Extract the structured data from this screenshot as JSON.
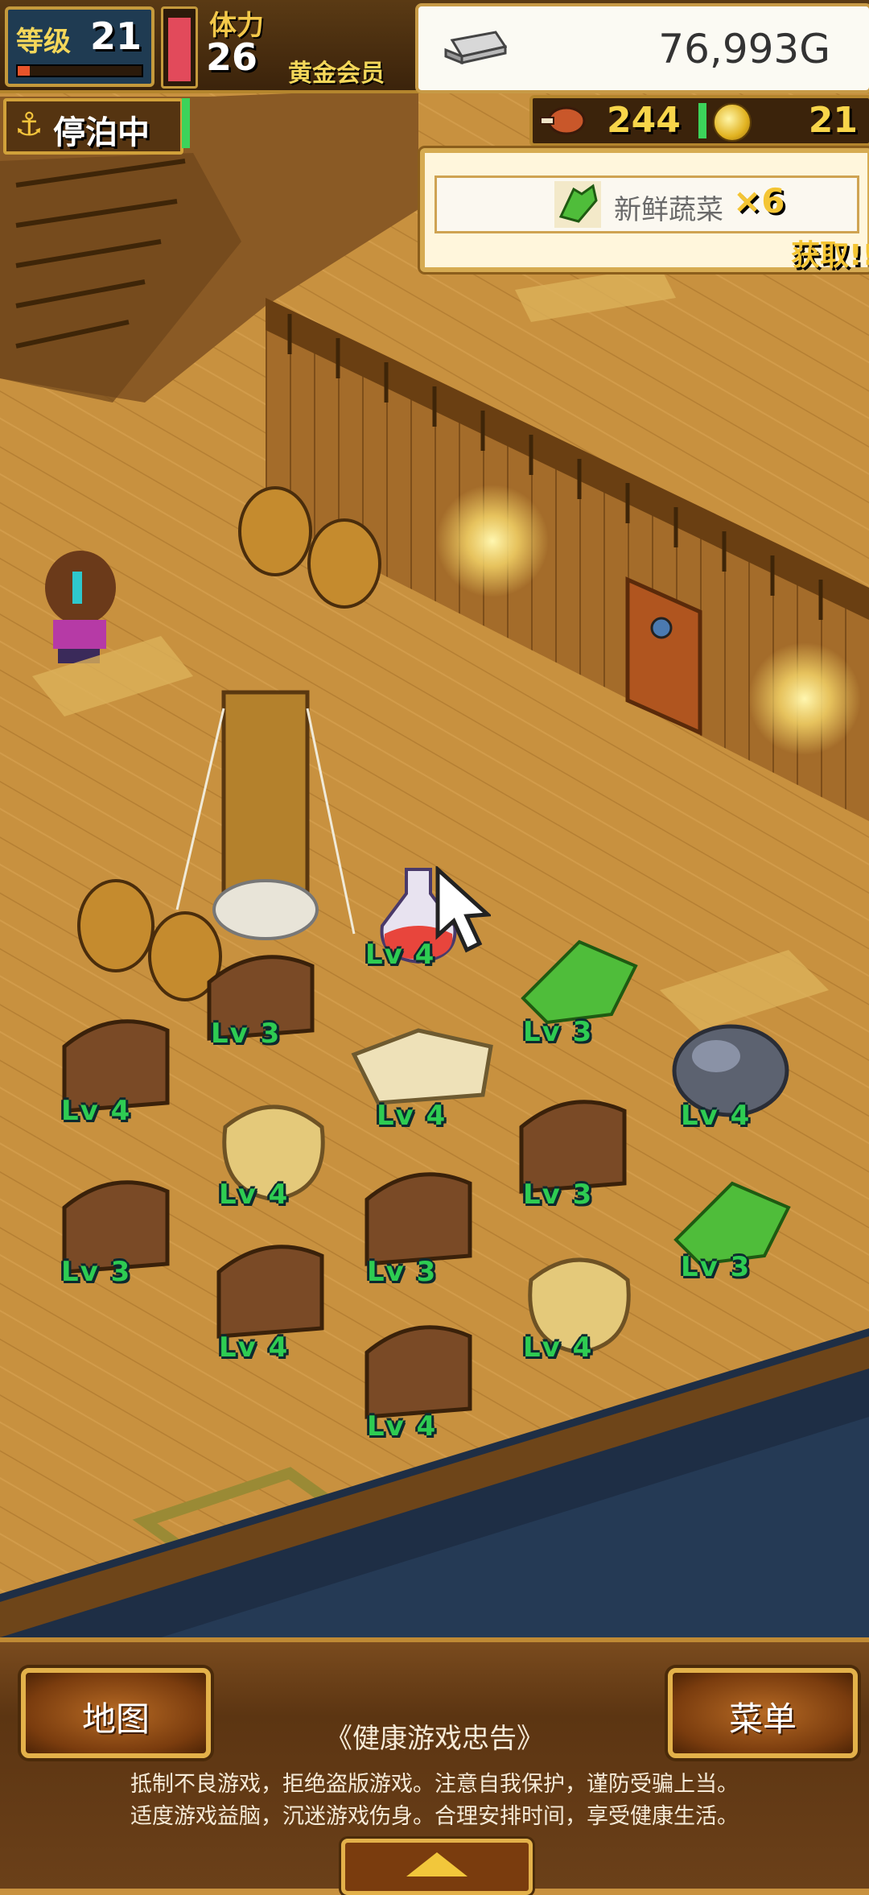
{
  "hud": {
    "level_label": "等级",
    "level_value": "21",
    "stamina_label": "体力",
    "stamina_value": "26",
    "member_label": "黄金会员",
    "gold_value": "76,993G",
    "docked_label": "停泊中",
    "food_value": "244",
    "coin_value": "21"
  },
  "notification": {
    "item_name": "新鲜蔬菜",
    "multiplier": "×6",
    "claim_label": "获取!!"
  },
  "items": [
    {
      "kind": "potion",
      "level": "Lv 4"
    },
    {
      "kind": "chest",
      "level": "Lv 3"
    },
    {
      "kind": "vegetables",
      "level": "Lv 3"
    },
    {
      "kind": "chest",
      "level": "Lv 4"
    },
    {
      "kind": "cloth",
      "level": "Lv 4"
    },
    {
      "kind": "ore",
      "level": "Lv 4"
    },
    {
      "kind": "sack",
      "level": "Lv 4"
    },
    {
      "kind": "chest",
      "level": "Lv 3"
    },
    {
      "kind": "chest",
      "level": "Lv 3"
    },
    {
      "kind": "chest",
      "level": "Lv 3"
    },
    {
      "kind": "vegetables",
      "level": "Lv 3"
    },
    {
      "kind": "chest",
      "level": "Lv 4"
    },
    {
      "kind": "sack",
      "level": "Lv 4"
    },
    {
      "kind": "chest",
      "level": "Lv 4"
    }
  ],
  "bottom": {
    "map_label": "地图",
    "menu_label": "菜单",
    "notice_title": "《健康游戏忠告》",
    "notice_line1": "抵制不良游戏，拒绝盗版游戏。注意自我保护，谨防受骗上当。",
    "notice_line2": "适度游戏益脑，沉迷游戏伤身。合理安排时间，享受健康生活。"
  },
  "colors": {
    "deck": "#c8913f",
    "level_text": "#2ecc52",
    "hud_gold": "#f7d54a"
  }
}
